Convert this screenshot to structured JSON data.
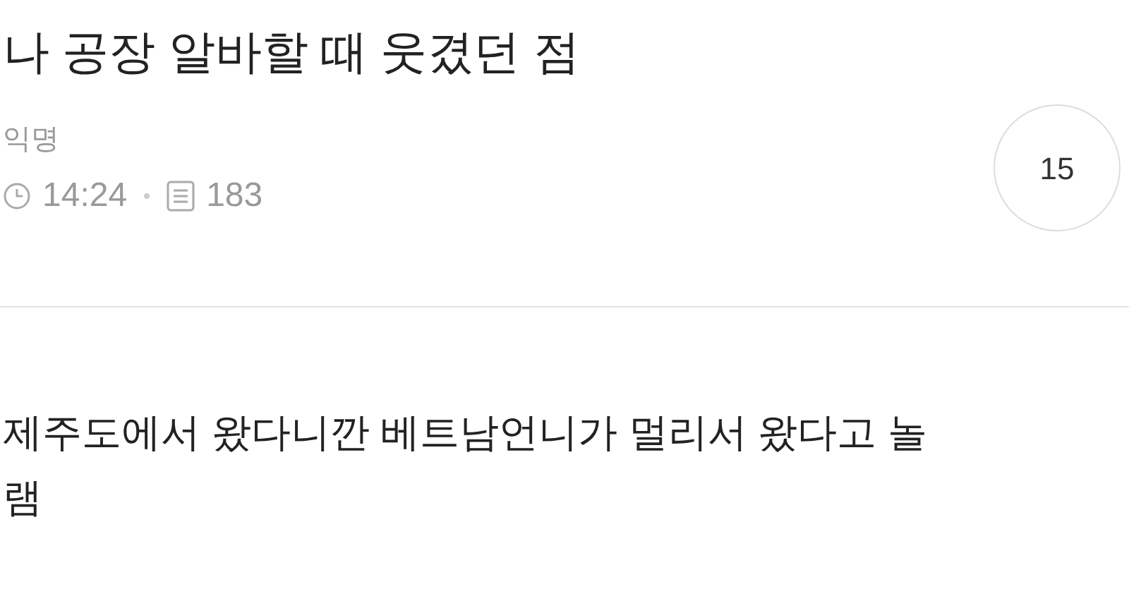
{
  "post": {
    "title": "나 공장 알바할 때 웃겼던 점",
    "author": "익명",
    "time": "14:24",
    "views": "183",
    "comment_count": "15",
    "body": "제주도에서 왔다니깐 베트남언니가 멀리서 왔다고 놀램"
  }
}
